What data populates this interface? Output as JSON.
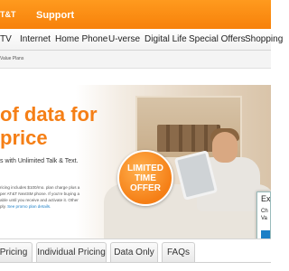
{
  "header": {
    "brand": "T&T",
    "support_label": "Support"
  },
  "nav": {
    "items": [
      "TV",
      "Internet",
      "Home Phone",
      "U-verse",
      "Digital Life",
      "Special Offers",
      "Shopping"
    ]
  },
  "breadcrumb": {
    "text": "Value Plans"
  },
  "hero": {
    "headline_line1": "of data for",
    "headline_line2": "price",
    "subhead": "s with Unlimited Talk & Text.",
    "fine_print_1": "ricing includes $100/mo. plan charge plus a",
    "fine_print_2": "per AT&T NextSM phone. If you're buying a",
    "fine_print_3": "able until you receive and activate it. Other",
    "fine_print_4": "ply.",
    "fine_print_link": "See promo plan details.",
    "badge_line1": "LIMITED",
    "badge_line2": "TIME",
    "badge_line3": "OFFER"
  },
  "popup": {
    "title": "Ex",
    "line1": "Ch",
    "line2": "Va"
  },
  "tabs": {
    "items": [
      "Pricing",
      "Individual Pricing",
      "Data Only",
      "FAQs"
    ]
  },
  "colors": {
    "brand_orange": "#f57f16",
    "link_blue": "#1c7fc6"
  }
}
